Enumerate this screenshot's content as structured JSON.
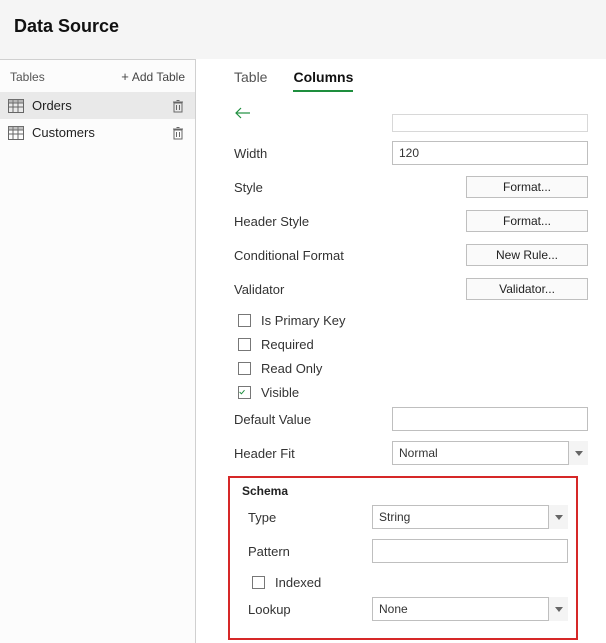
{
  "header": {
    "title": "Data Source"
  },
  "sidebar": {
    "tables_label": "Tables",
    "add_table_label": "Add Table",
    "items": [
      {
        "label": "Orders",
        "selected": true
      },
      {
        "label": "Customers",
        "selected": false
      }
    ]
  },
  "tabs": {
    "table_label": "Table",
    "columns_label": "Columns"
  },
  "form": {
    "width_label": "Width",
    "width_value": "120",
    "style_label": "Style",
    "style_button": "Format...",
    "header_style_label": "Header Style",
    "header_style_button": "Format...",
    "conditional_format_label": "Conditional Format",
    "conditional_format_button": "New Rule...",
    "validator_label": "Validator",
    "validator_button": "Validator...",
    "is_primary_key_label": "Is Primary Key",
    "required_label": "Required",
    "read_only_label": "Read Only",
    "visible_label": "Visible",
    "default_value_label": "Default Value",
    "default_value_value": "",
    "header_fit_label": "Header Fit",
    "header_fit_value": "Normal"
  },
  "schema": {
    "legend": "Schema",
    "type_label": "Type",
    "type_value": "String",
    "pattern_label": "Pattern",
    "pattern_value": "",
    "indexed_label": "Indexed",
    "lookup_label": "Lookup",
    "lookup_value": "None"
  }
}
